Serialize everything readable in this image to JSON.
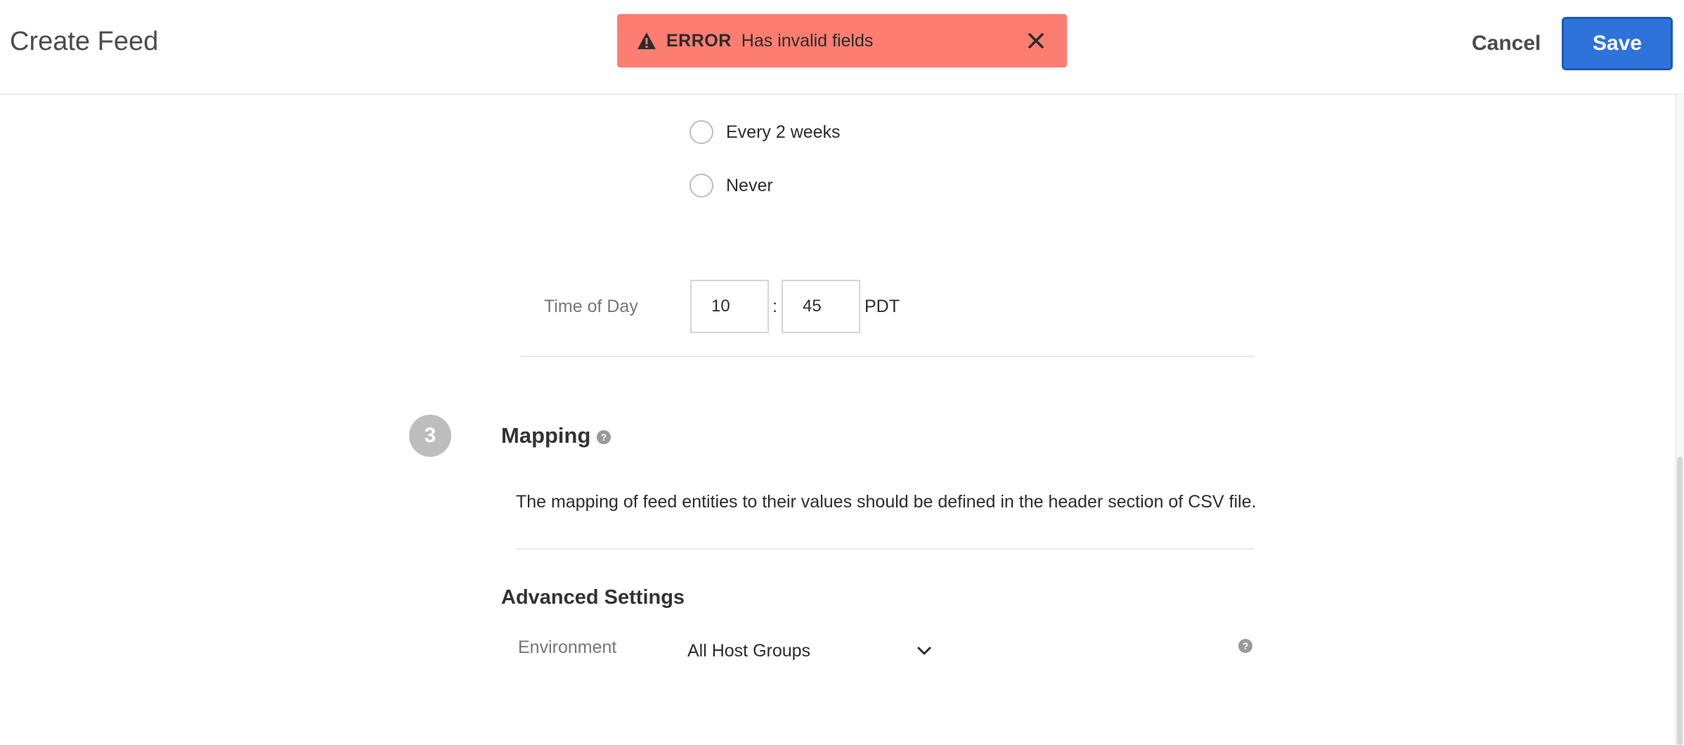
{
  "header": {
    "title": "Create Feed",
    "cancel_label": "Cancel",
    "save_label": "Save"
  },
  "toast": {
    "level": "ERROR",
    "message": "Has invalid fields",
    "color": "#fd7d71"
  },
  "schedule": {
    "options": [
      {
        "label": "Every 2 weeks",
        "selected": false
      },
      {
        "label": "Never",
        "selected": false
      }
    ],
    "time_of_day": {
      "label": "Time of Day",
      "hour": "10",
      "separator": ":",
      "minute": "45",
      "timezone": "PDT"
    }
  },
  "mapping": {
    "step_number": "3",
    "title": "Mapping",
    "description": "The mapping of feed entities to their values should be defined in the header section of CSV file."
  },
  "advanced": {
    "title": "Advanced Settings",
    "environment_label": "Environment",
    "environment_value": "All Host Groups"
  },
  "colors": {
    "accent": "#2d73d9",
    "error": "#fd7d71",
    "badge": "#bdbdbd"
  },
  "icons": {
    "warning": "warning-icon",
    "close": "close-icon",
    "help": "help-icon",
    "chevron": "chevron-down-icon"
  }
}
